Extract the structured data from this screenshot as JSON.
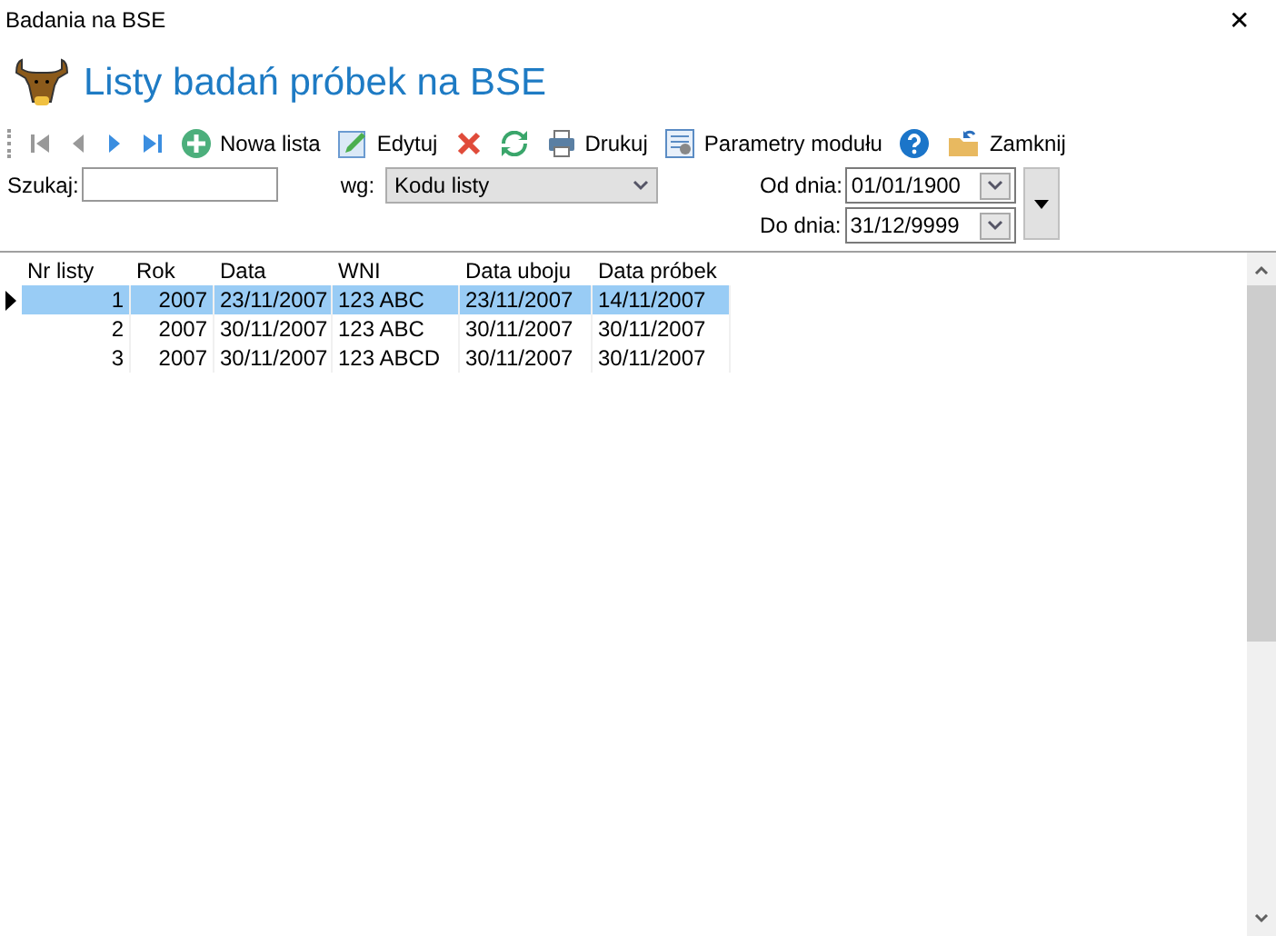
{
  "window": {
    "title": "Badania na BSE",
    "close": "✕"
  },
  "header": {
    "title": "Listy badań próbek na BSE"
  },
  "toolbar": [
    {
      "kind": "first"
    },
    {
      "kind": "prev"
    },
    {
      "kind": "next"
    },
    {
      "kind": "last"
    },
    {
      "kind": "add",
      "label": "Nowa lista"
    },
    {
      "kind": "edit",
      "label": "Edytuj"
    },
    {
      "kind": "delete"
    },
    {
      "kind": "refresh"
    },
    {
      "kind": "print",
      "label": "Drukuj"
    },
    {
      "kind": "params",
      "label": "Parametry modułu"
    },
    {
      "kind": "help"
    },
    {
      "kind": "close",
      "label": "Zamknij"
    }
  ],
  "search": {
    "label": "Szukaj:",
    "by_label": "wg:",
    "by_value": "Kodu listy"
  },
  "dates": [
    {
      "label": "Od dnia:",
      "value": "01/01/1900"
    },
    {
      "label": "Do dnia:",
      "value": "31/12/9999"
    }
  ],
  "table": {
    "columns": [
      "Nr listy",
      "Rok",
      "Data",
      "WNI",
      "Data uboju",
      "Data próbek"
    ],
    "rows": [
      {
        "selected": true,
        "cells": [
          "1",
          "2007",
          "23/11/2007",
          "123 ABC",
          "23/11/2007",
          "14/11/2007"
        ]
      },
      {
        "selected": false,
        "cells": [
          "2",
          "2007",
          "30/11/2007",
          "123 ABC",
          "30/11/2007",
          "30/11/2007"
        ]
      },
      {
        "selected": false,
        "cells": [
          "3",
          "2007",
          "30/11/2007",
          "123 ABCD",
          "30/11/2007",
          "30/11/2007"
        ]
      }
    ]
  }
}
